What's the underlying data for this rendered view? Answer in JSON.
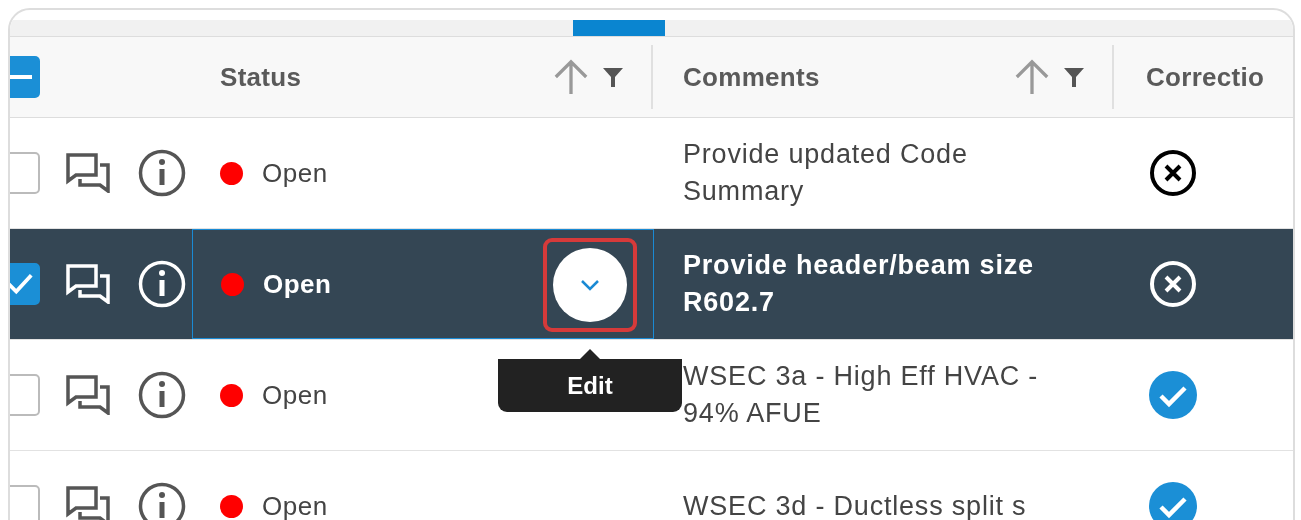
{
  "table": {
    "header_checkbox": {
      "indeterminate": true
    },
    "columns": [
      {
        "label": "Status",
        "sortable": true
      },
      {
        "label": "Comments",
        "sortable": true
      },
      {
        "label": "Correctio",
        "sortable": false
      }
    ],
    "rows": [
      {
        "checked": false,
        "selected": false,
        "status": "Open",
        "color": "#ff0000",
        "comment": "Provide updated Code Summary",
        "accepted": false
      },
      {
        "checked": true,
        "selected": true,
        "status": "Open",
        "color": "#ff0000",
        "comment": "Provide header/beam size R602.7",
        "accepted": false,
        "edit_button": {
          "tooltip": "Edit",
          "highlighted": true
        }
      },
      {
        "checked": false,
        "selected": false,
        "status": "Open",
        "color": "#ff0000",
        "comment": "WSEC 3a - High Eff HVAC - 94% AFUE",
        "accepted": true
      },
      {
        "checked": false,
        "selected": false,
        "status": "Open",
        "color": "#ff0000",
        "comment": "WSEC 3d - Ductless split s",
        "accepted": true
      }
    ]
  }
}
